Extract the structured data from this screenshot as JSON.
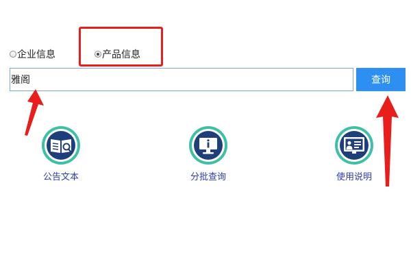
{
  "search_type": {
    "options": [
      {
        "label": "企业信息",
        "checked": false
      },
      {
        "label": "产品信息",
        "checked": true
      }
    ]
  },
  "search": {
    "value": "雅阁",
    "button_label": "查询"
  },
  "features": [
    {
      "label": "公告文本",
      "icon": "document-search-icon"
    },
    {
      "label": "分批查询",
      "icon": "info-monitor-icon"
    },
    {
      "label": "使用说明",
      "icon": "presenter-screen-icon"
    }
  ],
  "colors": {
    "accent": "#2e8ff2",
    "annotation_red": "#ea1d1d",
    "icon_ring": "#3fbfa8",
    "icon_core": "#1f3f7a",
    "link_text": "#2b3bb5"
  }
}
